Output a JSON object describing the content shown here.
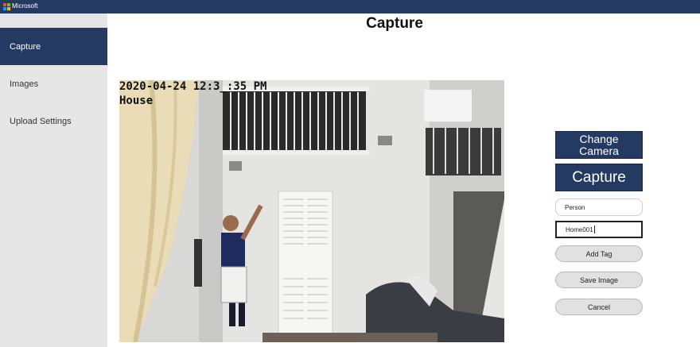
{
  "app": {
    "brand": "Microsoft"
  },
  "sidebar": {
    "items": [
      {
        "label": "Capture",
        "active": true
      },
      {
        "label": "Images",
        "active": false
      },
      {
        "label": "Upload Settings",
        "active": false
      }
    ]
  },
  "page": {
    "title": "Capture"
  },
  "camera": {
    "timestamp": "2020-04-24 12:3_:35 PM",
    "location": "House"
  },
  "controls": {
    "change_camera_line1": "Change",
    "change_camera_line2": "Camera",
    "capture_label": "Capture",
    "tag_field_value": "Person",
    "name_field_value": "Home001",
    "add_tag_label": "Add Tag",
    "save_image_label": "Save Image",
    "cancel_label": "Cancel"
  },
  "colors": {
    "accent": "#243a63",
    "sidebar_bg": "#e6e6e6",
    "button_light": "#e1e1e1"
  },
  "icons": [
    "microsoft-logo-icon"
  ]
}
